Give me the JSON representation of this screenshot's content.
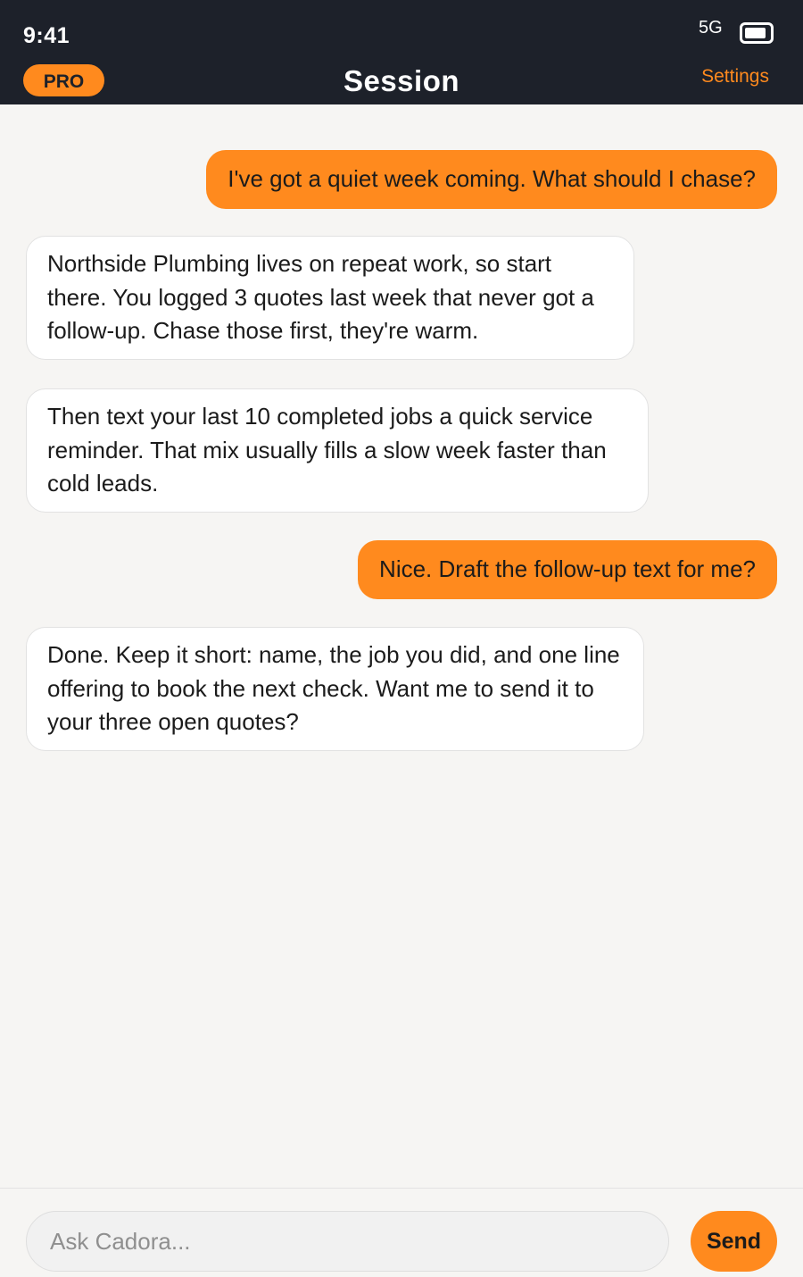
{
  "status": {
    "time": "9:41",
    "network": "5G",
    "battery_level": 0.9
  },
  "header": {
    "badge": "PRO",
    "title": "Session",
    "settings_label": "Settings"
  },
  "messages": [
    {
      "role": "user",
      "text": "I've got a quiet week coming. What should I chase?"
    },
    {
      "role": "assistant",
      "text": "Northside Plumbing lives on repeat work, so start there. You logged 3 quotes last week that never got a follow-up. Chase those first, they're warm."
    },
    {
      "role": "assistant",
      "text": "Then text your last 10 completed jobs a quick service reminder. That mix usually fills a slow week faster than cold leads."
    },
    {
      "role": "user",
      "text": "Nice. Draft the follow-up text for me?"
    },
    {
      "role": "assistant",
      "text": "Done. Keep it short: name, the job you did, and one line offering to book the next check. Want me to send it to your three open quotes?"
    }
  ],
  "composer": {
    "placeholder": "Ask Cadora...",
    "value": "",
    "send_label": "Send"
  },
  "colors": {
    "accent": "#ff8a1e",
    "header_bg": "#1d212a",
    "page_bg": "#f6f5f3",
    "bubble_bot": "#ffffff"
  }
}
